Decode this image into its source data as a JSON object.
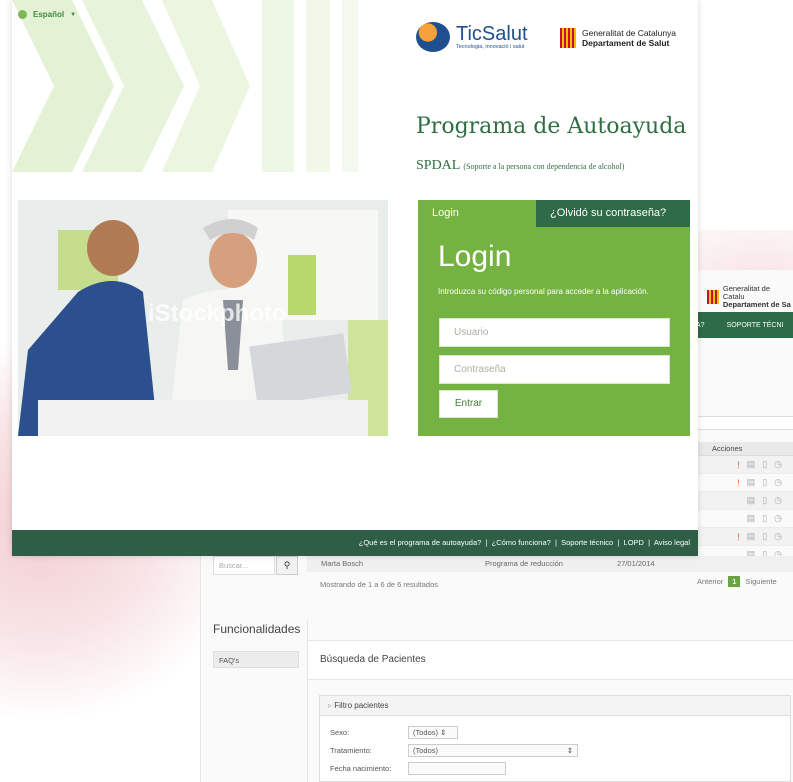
{
  "front": {
    "language": "Español",
    "ticsalut": {
      "name": "TicSalut",
      "tagline": "Tecnologia, innovació i salut"
    },
    "generalitat": {
      "line1": "Generalitat de Catalunya",
      "line2": "Departament de Salut"
    },
    "program_title": "Programa de Autoayuda",
    "spdal": {
      "acronym": "SPDAL",
      "detail": "(Soporte a la persona con dependencia de alcohol)"
    },
    "photo_watermark": "iStockphoto",
    "login": {
      "tab_login": "Login",
      "tab_forgot": "¿Olvidó su contraseña?",
      "title": "Login",
      "description": "Introduzca su código personal para acceder a la aplicación.",
      "user_placeholder": "Usuario",
      "password_placeholder": "Contraseña",
      "submit": "Entrar"
    },
    "footer": {
      "links": [
        "¿Qué es el programa de autoayuda?",
        "¿Cómo funciona?",
        "Soporte técnico",
        "LOPD",
        "Aviso legal"
      ],
      "separator": "|"
    }
  },
  "admin": {
    "header": {
      "line1": "Generalitat de Catalu",
      "line2": "Departament de Sa"
    },
    "nav": {
      "item1": "A?",
      "item2": "SOPORTE TÉCNI"
    },
    "table": {
      "actions_header": "Acciones",
      "rows": [
        {
          "warn": true
        },
        {
          "warn": true
        },
        {
          "warn": false
        },
        {
          "warn": false
        },
        {
          "warn": true
        },
        {
          "warn": false
        }
      ],
      "last_row": {
        "name": "Marta Bosch",
        "program": "Programa de reducción",
        "date": "27/01/2014"
      }
    },
    "search_placeholder": "Buscar...",
    "results_text": "Mostrando de 1 a 6 de 6 resultados",
    "pager": {
      "prev": "Anterior",
      "page": "1",
      "next": "Siguiente"
    },
    "functionalities_title": "Funcionalidades",
    "faq": "FAQ's",
    "main_title": "Búsqueda de Pacientes",
    "filter": {
      "title": "Filtro pacientes",
      "sexo_label": "Sexo:",
      "sexo_value": "(Todos)",
      "tratamiento_label": "Tratamiento:",
      "tratamiento_value": "(Todos)",
      "fecha_label": "Fecha nacimiento:"
    }
  }
}
